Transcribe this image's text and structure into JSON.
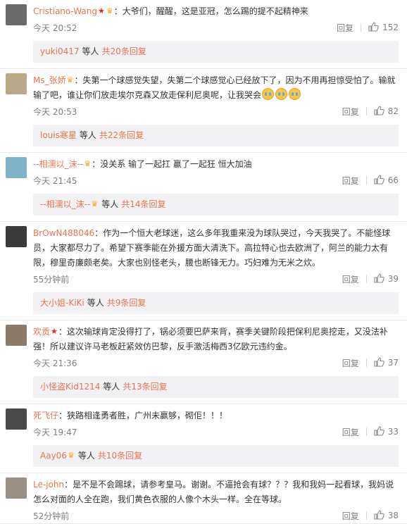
{
  "comments": [
    {
      "user": "Cristiano-Wang",
      "badges": [
        "star",
        "crown"
      ],
      "text": "：大爷们，醒醒，这是亚冠，怎么踢的提不起精神来",
      "emojis": 0,
      "time": "今天 20:52",
      "reply_label": "回复",
      "likes": "152",
      "avatar_color": "#6b6b6b",
      "sub": {
        "user": "yuki0417",
        "mid": "等人",
        "count": "共20条回复",
        "badge": false
      }
    },
    {
      "user": "Ms_张娇",
      "badges": [
        "crown"
      ],
      "text": "：失第一个球感觉失望，失第二个球感觉心已经放下了，因为不用再担惊受怕了。输就输了吧，谁让你们放走埃尔克森又放走保利尼奥呢，让我哭会",
      "emojis": 3,
      "time": "今天 20:53",
      "reply_label": "回复",
      "likes": "82",
      "avatar_color": "#b7a98a",
      "sub": {
        "user": "louis寒星",
        "mid": "等人",
        "count": "共22条回复",
        "badge": false
      }
    },
    {
      "user": "--相濡以_沫--",
      "badges": [
        "crown"
      ],
      "text": "：没关系  输了一起扛  赢了一起狂  恒大加油",
      "emojis": 0,
      "time": "今天 21:45",
      "reply_label": "回复",
      "likes": "66",
      "avatar_color": "#7fb3c9",
      "sub": {
        "user": "--相濡以_沫--",
        "mid": "等人",
        "count": "共14条回复",
        "badge": true
      }
    },
    {
      "user": "BrOwN488046",
      "badges": [],
      "text": "：作为一个恒大老球迷，这么多年我重来没为球队哭过，今天我哭了。不能怪球员，大家都尽力了。希望下赛季能在外援方面大清洗下。高拉特心也去欧洲了，阿兰的能力太有限，穆里奇廉颇老矣。大家也别怪老头，腰也断锋无力。巧妇难为无米之炊。",
      "emojis": 0,
      "time": "55分钟前",
      "reply_label": "回复",
      "likes": "39",
      "avatar_color": "#3a3a3a",
      "sub": {
        "user": "大小姐-KiKi",
        "mid": "等人",
        "count": "共9条回复",
        "badge": false
      }
    },
    {
      "user": "欢贡",
      "badges": [
        "star"
      ],
      "text": "：这次输球肯定没得打了，锅必须要巴萨来背，赛季关键阶段把保利尼奥挖走，又没法补强！所以建议许马老板赶紧效仿巴黎，反手激活梅西3亿欧元违约金。",
      "emojis": 0,
      "time": "今天 21:36",
      "reply_label": "回复",
      "likes": "37",
      "avatar_color": "#8a7a6a",
      "sub": {
        "user": "小怪盗Kid1214",
        "mid": "等人",
        "count": "共13条回复",
        "badge": false
      }
    },
    {
      "user": "死飞仔",
      "badges": [],
      "text": "：狭路相逢勇者胜，广州未赢够，砌佢！！！",
      "emojis": 0,
      "time": "今天 19:47",
      "reply_label": "回复",
      "likes": "33",
      "avatar_color": "#4a4a4a",
      "sub": {
        "user": "Aay06",
        "mid": "等人",
        "count": "共10条回复",
        "badge": true
      }
    },
    {
      "user": "Le-john",
      "badges": [],
      "text": "：是不是不会踢球，请参考皇马。谢谢。不逼抢会有球？？？我和我妈一起看球，我妈说怎么对面的人全在跑，我们黄色衣服的人像个木头一样。全在等球。",
      "emojis": 0,
      "time": "52分钟前",
      "reply_label": "回复",
      "likes": "38",
      "avatar_color": "#9a8f85",
      "sub": null
    }
  ]
}
